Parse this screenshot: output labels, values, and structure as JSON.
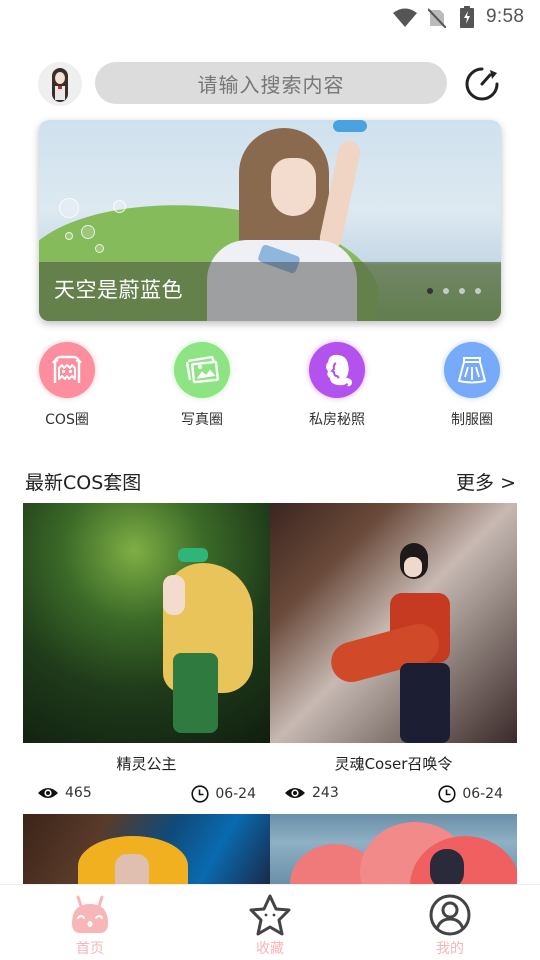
{
  "status_bar": {
    "time": "9:58",
    "icons": [
      "wifi-icon",
      "no-sim-icon",
      "battery-charging-icon"
    ]
  },
  "header": {
    "avatar_icon": "user-avatar",
    "search_placeholder": "请输入搜索内容",
    "refresh_icon": "refresh-icon"
  },
  "banner": {
    "caption": "天空是蔚蓝色",
    "slide_count": 4,
    "active_slide": 1
  },
  "categories": [
    {
      "label": "COS圈",
      "icon": "ghost-mask-icon",
      "color": "#fd8e9e"
    },
    {
      "label": "写真圈",
      "icon": "photos-icon",
      "color": "#8de482"
    },
    {
      "label": "私房秘照",
      "icon": "woman-hair-icon",
      "color": "#b452ee"
    },
    {
      "label": "制服圈",
      "icon": "skirt-icon",
      "color": "#77abf9"
    }
  ],
  "section": {
    "title": "最新COS套图",
    "more_label": "更多 >"
  },
  "cards": [
    {
      "title": "精灵公主",
      "views": "465",
      "date": "06-24"
    },
    {
      "title": "灵魂Coser召唤令",
      "views": "243",
      "date": "06-24"
    },
    {
      "title": "",
      "views": "",
      "date": ""
    },
    {
      "title": "",
      "views": "",
      "date": ""
    }
  ],
  "bottom_nav": [
    {
      "label": "首页",
      "icon": "home-bunny-icon",
      "active": true
    },
    {
      "label": "收藏",
      "icon": "star-icon",
      "active": false
    },
    {
      "label": "我的",
      "icon": "profile-icon",
      "active": false
    }
  ],
  "colors": {
    "accent_pink": "#f8b6b8",
    "search_bg": "#dcdcdc",
    "icon_dark": "#444444"
  }
}
